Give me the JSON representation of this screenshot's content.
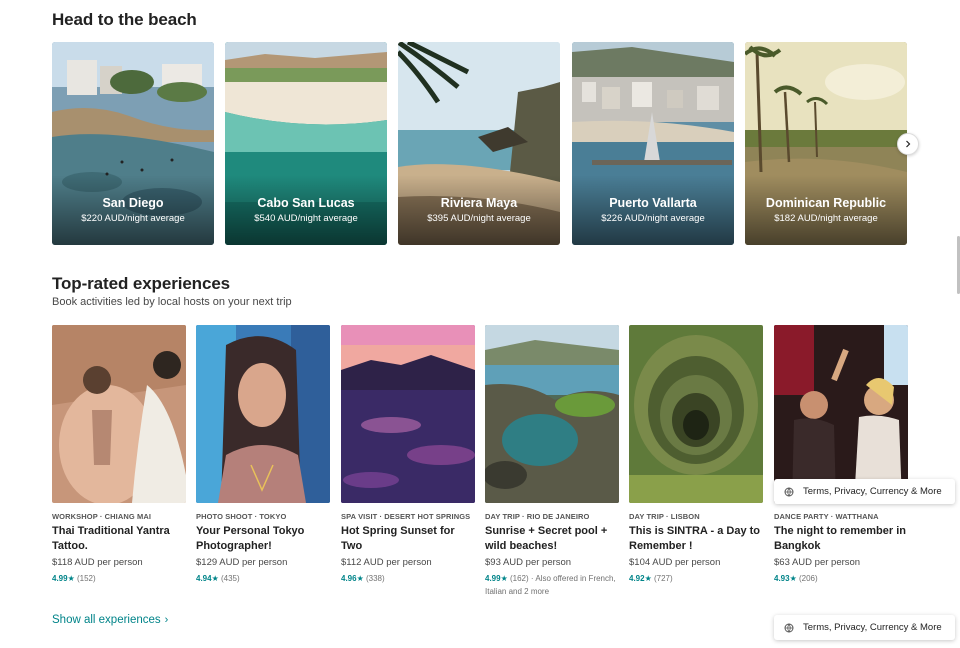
{
  "beach": {
    "title": "Head to the beach",
    "cards": [
      {
        "name": "San Diego",
        "price": "$220 AUD/night average"
      },
      {
        "name": "Cabo San Lucas",
        "price": "$540 AUD/night average"
      },
      {
        "name": "Riviera Maya",
        "price": "$395 AUD/night average"
      },
      {
        "name": "Puerto Vallarta",
        "price": "$226 AUD/night average"
      },
      {
        "name": "Dominican Republic",
        "price": "$182 AUD/night average"
      }
    ],
    "next_icon": "chevron-right-icon"
  },
  "experiences": {
    "title": "Top-rated experiences",
    "subtitle": "Book activities led by local hosts on your next trip",
    "cards": [
      {
        "category": "WORKSHOP · CHIANG MAI",
        "title": "Thai Traditional Yantra Tattoo.",
        "price": "$118 AUD per person",
        "score": "4.99",
        "reviews": "(152)",
        "extra": ""
      },
      {
        "category": "PHOTO SHOOT · TOKYO",
        "title": "Your Personal Tokyo Photographer!",
        "price": "$129 AUD per person",
        "score": "4.94",
        "reviews": "(435)",
        "extra": ""
      },
      {
        "category": "SPA VISIT · DESERT HOT SPRINGS",
        "title": "Hot Spring Sunset for Two",
        "price": "$112 AUD per person",
        "score": "4.96",
        "reviews": "(338)",
        "extra": ""
      },
      {
        "category": "DAY TRIP · RIO DE JANEIRO",
        "title": "Sunrise + Secret pool + wild beaches!",
        "price": "$93 AUD per person",
        "score": "4.99",
        "reviews": "(162)",
        "extra": " · Also offered in French, Italian and 2 more"
      },
      {
        "category": "DAY TRIP · LISBON",
        "title": "This is SINTRA - a Day to Remember !",
        "price": "$104 AUD per person",
        "score": "4.92",
        "reviews": "(727)",
        "extra": ""
      },
      {
        "category": "DANCE PARTY · WATTHANA",
        "title": "The night to remember in Bangkok",
        "price": "$63 AUD per person",
        "score": "4.93",
        "reviews": "(206)",
        "extra": ""
      }
    ],
    "star": "★",
    "show_all": "Show all experiences",
    "show_all_chevron": "›"
  },
  "footer": {
    "label": "Terms, Privacy, Currency & More",
    "icon": "globe-icon"
  }
}
